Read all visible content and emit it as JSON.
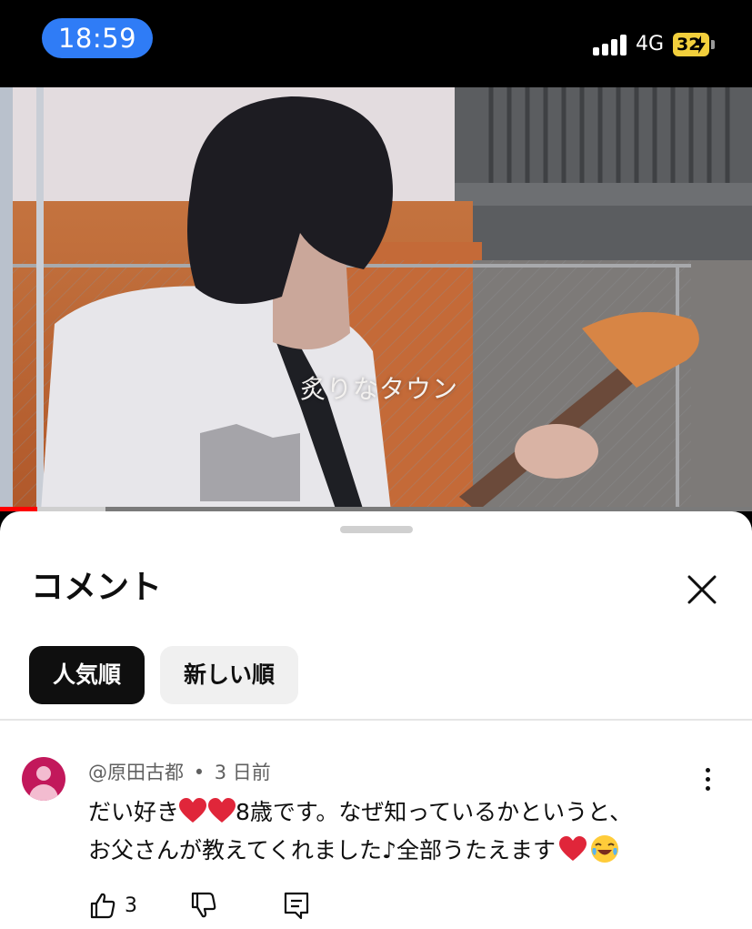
{
  "status_bar": {
    "time": "18:59",
    "network": "4G",
    "battery_level": "32",
    "colors": {
      "time_pill": "#2f7cf6",
      "battery": "#f2cf3c"
    }
  },
  "video": {
    "caption": "炙りなタウン",
    "progress_fraction": 0.05,
    "buffered_fraction": 0.14
  },
  "comments_panel": {
    "title": "コメント",
    "close_icon": "close-icon",
    "sort_chips": [
      {
        "label": "人気順",
        "selected": true
      },
      {
        "label": "新しい順",
        "selected": false
      }
    ],
    "comments": [
      {
        "author": "@原田古都",
        "time_ago": "3 日前",
        "separator": "•",
        "line1_a": "だい好き",
        "line1_b": "8歳です。なぜ知っているかというと、",
        "line2": "お父さんが教えてくれました♪全部うたえます",
        "emojis": [
          "heart-icon",
          "heart-icon",
          "heart-icon",
          "laughing-face-icon"
        ],
        "like_count": "3",
        "actions": [
          "thumbs-up-icon",
          "thumbs-down-icon",
          "reply-icon"
        ]
      }
    ]
  }
}
